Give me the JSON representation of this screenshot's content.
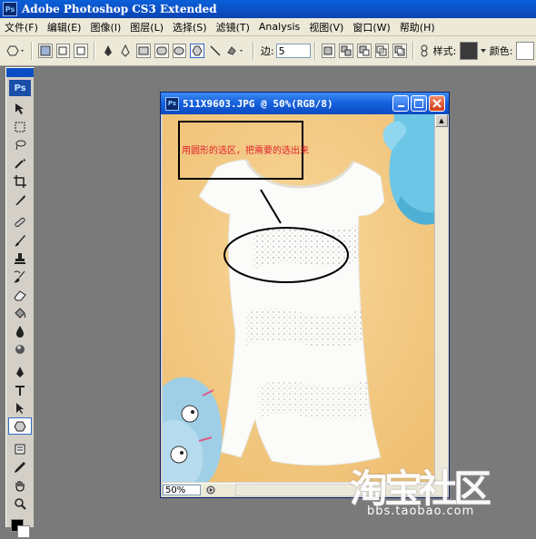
{
  "app": {
    "title": "Adobe Photoshop CS3 Extended",
    "logo": "Ps"
  },
  "menu": [
    {
      "label": "文件(F)"
    },
    {
      "label": "编辑(E)"
    },
    {
      "label": "图像(I)"
    },
    {
      "label": "图层(L)"
    },
    {
      "label": "选择(S)"
    },
    {
      "label": "滤镜(T)"
    },
    {
      "label": "Analysis"
    },
    {
      "label": "视图(V)"
    },
    {
      "label": "窗口(W)"
    },
    {
      "label": "帮助(H)"
    }
  ],
  "options": {
    "edge_label": "边:",
    "edge_value": "5",
    "style_label": "样式:",
    "color_label": "颜色:"
  },
  "toolbox": {
    "badge": "Ps"
  },
  "document": {
    "title": "511X9603.JPG @ 50%(RGB/8)",
    "zoom": "50%",
    "annotation": "用圆形的选区，把需要的选出来"
  },
  "watermark": {
    "brand": "淘宝社区",
    "url": "bbs.taobao.com"
  },
  "colors": {
    "title_bar": "#0c4fc4",
    "menu_bg": "#ece9d8",
    "workspace": "#7a7a7a",
    "canvas_bg": "#f2c77e",
    "annotation_text": "#e0202a"
  }
}
